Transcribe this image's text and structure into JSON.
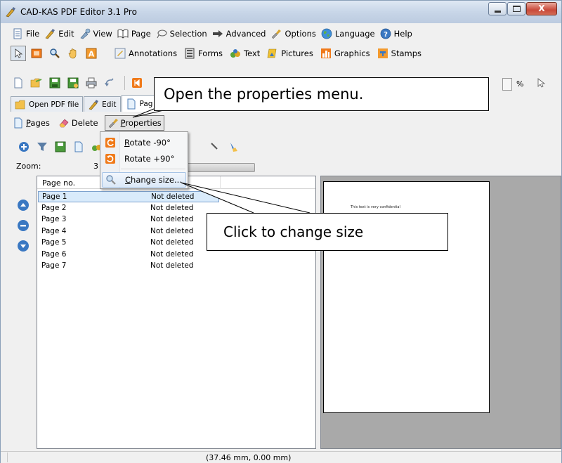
{
  "window": {
    "title": "CAD-KAS PDF Editor 3.1 Pro",
    "close_glyph": "X"
  },
  "menu": {
    "items": [
      {
        "label": "File",
        "icon": "file-icon"
      },
      {
        "label": "Edit",
        "icon": "edit-icon"
      },
      {
        "label": "View",
        "icon": "view-icon"
      },
      {
        "label": "Page",
        "icon": "page-icon"
      },
      {
        "label": "Selection",
        "icon": "selection-icon"
      },
      {
        "label": "Advanced",
        "icon": "advanced-icon"
      },
      {
        "label": "Options",
        "icon": "options-icon"
      },
      {
        "label": "Language",
        "icon": "globe-icon"
      },
      {
        "label": "Help",
        "icon": "help-icon"
      }
    ]
  },
  "toolbar1": {
    "groups": [
      {
        "label": "Annotations",
        "icon": "annotations-icon"
      },
      {
        "label": "Forms",
        "icon": "forms-icon"
      },
      {
        "label": "Text",
        "icon": "text-icon"
      },
      {
        "label": "Pictures",
        "icon": "pictures-icon"
      },
      {
        "label": "Graphics",
        "icon": "graphics-icon"
      },
      {
        "label": "Stamps",
        "icon": "stamps-icon"
      }
    ]
  },
  "toolbar2": {
    "zoom_unit": "%"
  },
  "tabs": [
    {
      "label": "Open PDF file",
      "icon": "folder-icon"
    },
    {
      "label": "Edit",
      "icon": "edit-icon"
    },
    {
      "label": "Pag",
      "icon": "page-icon"
    }
  ],
  "subbar": {
    "pages_label": "Pages",
    "delete_label": "Delete",
    "properties_label": "Properties"
  },
  "zoom": {
    "label": "Zoom:",
    "value": "3"
  },
  "properties_menu": {
    "items": [
      {
        "label": "Rotate -90°",
        "icon": "rotate-left-icon"
      },
      {
        "label": "Rotate +90°",
        "icon": "rotate-right-icon"
      },
      {
        "label": "Change size...",
        "icon": "magnifier-icon"
      }
    ]
  },
  "page_list": {
    "header": "Page no.",
    "rows": [
      {
        "page": "Page 1",
        "status": "Not deleted"
      },
      {
        "page": "Page 2",
        "status": "Not deleted"
      },
      {
        "page": "Page 3",
        "status": "Not deleted"
      },
      {
        "page": "Page 4",
        "status": "Not deleted"
      },
      {
        "page": "Page 5",
        "status": "Not deleted"
      },
      {
        "page": "Page 6",
        "status": "Not deleted"
      },
      {
        "page": "Page 7",
        "status": "Not deleted"
      }
    ]
  },
  "preview": {
    "text": "This text is very confidential"
  },
  "status": {
    "coords": "(37.46 mm, 0.00 mm)"
  },
  "callouts": {
    "top": "Open the properties menu.",
    "bottom": "Click to change size"
  },
  "colors": {
    "selection": "#d9ebfb",
    "accent": "#3a78c2"
  }
}
